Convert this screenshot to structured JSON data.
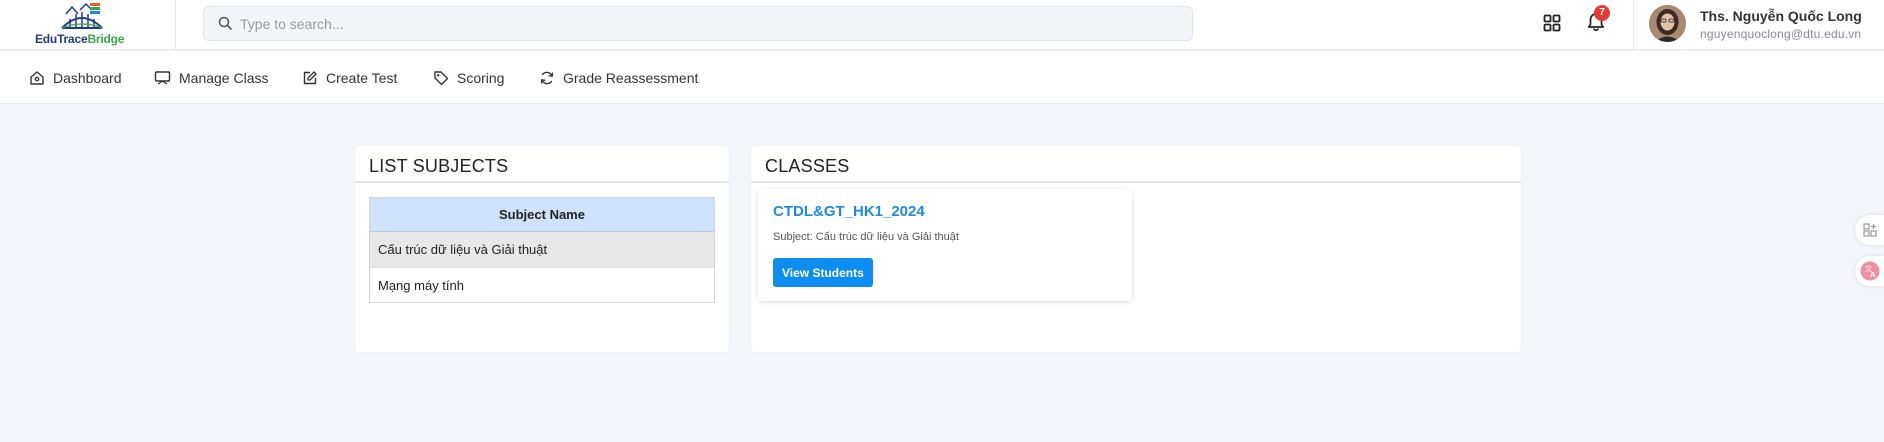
{
  "app": {
    "logo_text_a": "EduTrace",
    "logo_text_b": "Bridge",
    "logo_icon": "bridge-logo-icon"
  },
  "header": {
    "search": {
      "placeholder": "Type to search...",
      "value": "",
      "icon": "search-icon"
    },
    "apps_icon": "grid-apps-icon",
    "notifications": {
      "icon": "bell-icon",
      "count": "7"
    },
    "user": {
      "name": "Ths. Nguyễn Quốc Long",
      "email": "nguyenquoclong@dtu.edu.vn",
      "avatar_icon": "avatar"
    }
  },
  "nav": {
    "items": [
      {
        "label": "Dashboard",
        "icon": "home-icon"
      },
      {
        "label": "Manage Class",
        "icon": "presentation-board-icon"
      },
      {
        "label": "Create Test",
        "icon": "edit-icon"
      },
      {
        "label": "Scoring",
        "icon": "tag-icon"
      },
      {
        "label": "Grade Reassessment",
        "icon": "refresh-icon"
      }
    ]
  },
  "subjects_panel": {
    "title": "LIST SUBJECTS",
    "column_header": "Subject Name",
    "rows": [
      {
        "name": "Cấu trúc dữ liệu và Giải thuật",
        "selected": true
      },
      {
        "name": "Mạng máy tính",
        "selected": false
      }
    ]
  },
  "classes_panel": {
    "title": "CLASSES",
    "classes": [
      {
        "name": "CTDL&GT_HK1_2024",
        "subject": "Subject: Cấu trúc dữ liệu và Giải thuật",
        "button_label": "View Students"
      }
    ]
  },
  "floating": {
    "top_icon": "add-widget-icon",
    "bottom_icon": "translate-icon"
  },
  "colors": {
    "accent": "#1e88e5",
    "button": "#0d8df1",
    "table_header": "#cfe2fb",
    "badge": "#e53935",
    "background": "#f5f6fc"
  }
}
